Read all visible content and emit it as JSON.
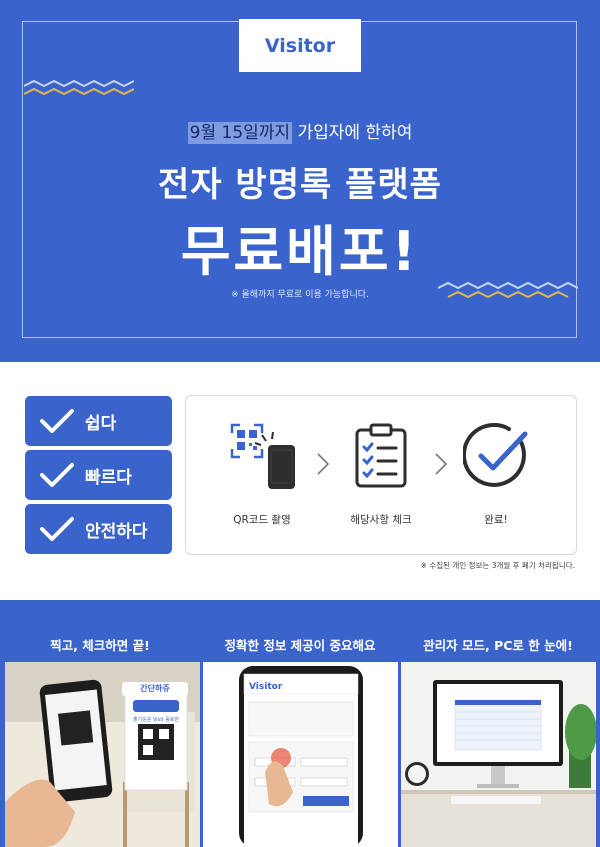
{
  "header": {
    "logo": "Visitor",
    "subline_highlight": "9월 15일까지",
    "subline_rest": " 가입자에 한하여",
    "title_line1": "전자 방명록 플랫폼",
    "title_line2": "무료배포!",
    "note": "※ 올해까지 무료로 이용 가능합니다."
  },
  "features": [
    {
      "label": "쉽다"
    },
    {
      "label": "빠르다"
    },
    {
      "label": "안전하다"
    }
  ],
  "steps": [
    {
      "label": "QR코드 촬영",
      "icon": "qr-phone-icon"
    },
    {
      "label": "해당사항 체크",
      "icon": "clipboard-checklist-icon"
    },
    {
      "label": "완료!",
      "icon": "check-circle-icon"
    }
  ],
  "footnote": "※ 수집된 개인 정보는 3개월 후 폐기 처리됩니다.",
  "panels": [
    {
      "caption": "찍고, 체크하면 끝!",
      "stand_title": "간단하쥬",
      "stand_text": "출기운운 Visit 등로한",
      "tag": "hint"
    },
    {
      "caption": "정확한 정보 제공이 중요해요",
      "app_name": "Visitor"
    },
    {
      "caption": "관리자 모드, PC로 한 눈에!"
    }
  ],
  "colors": {
    "brand_blue": "#3a64cc",
    "highlight": "#7f9ce0",
    "white": "#ffffff"
  }
}
